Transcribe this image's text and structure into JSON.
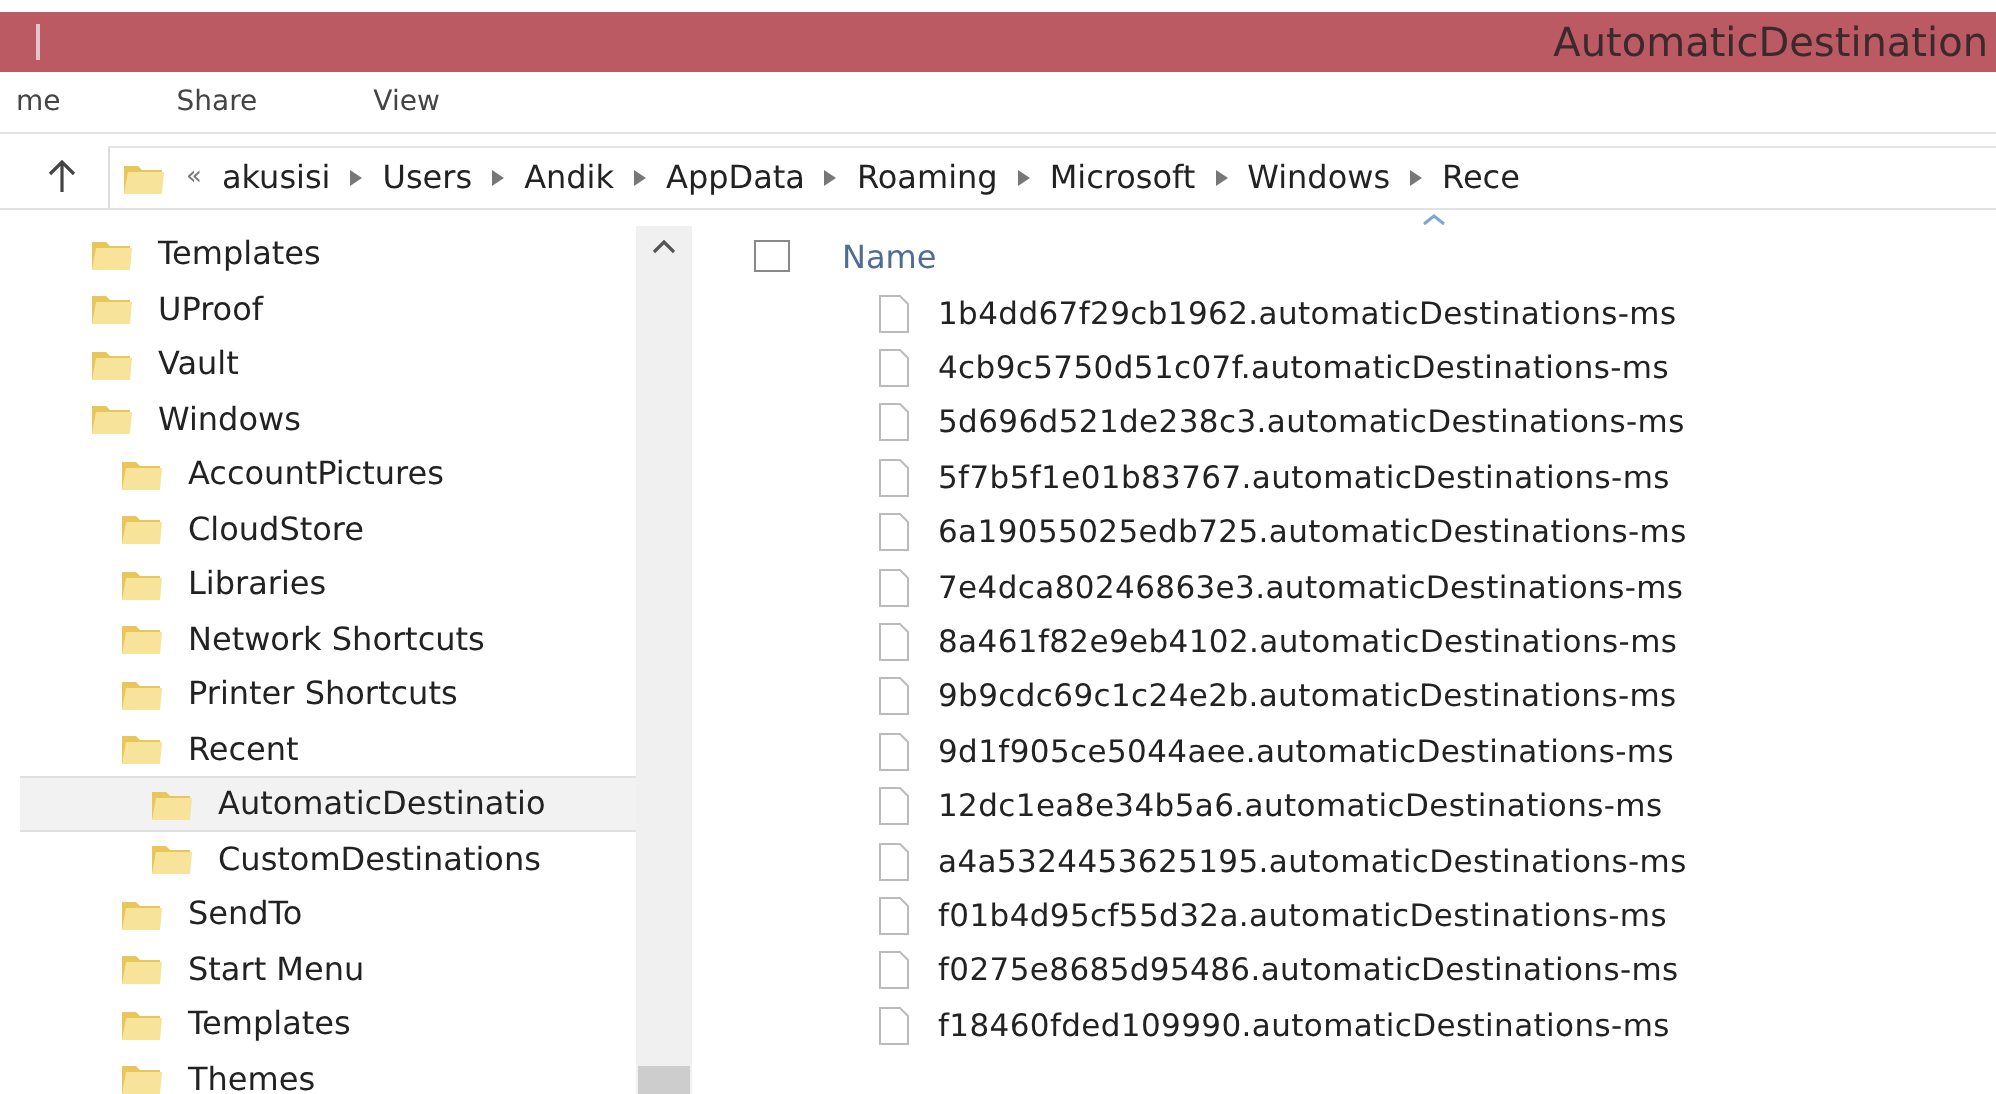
{
  "window": {
    "title": "AutomaticDestination"
  },
  "ribbon_tabs": [
    {
      "label": "me"
    },
    {
      "label": "Share"
    },
    {
      "label": "View"
    }
  ],
  "address_bar": {
    "overflow": "«",
    "path": [
      "akusisi",
      "Users",
      "Andik",
      "AppData",
      "Roaming",
      "Microsoft",
      "Windows",
      "Rece"
    ]
  },
  "navigation_tree": [
    {
      "label": "Templates",
      "selected": false
    },
    {
      "label": "UProof",
      "selected": false
    },
    {
      "label": "Vault",
      "selected": false
    },
    {
      "label": "Windows",
      "selected": false,
      "children": [
        {
          "label": "AccountPictures",
          "selected": false
        },
        {
          "label": "CloudStore",
          "selected": false
        },
        {
          "label": "Libraries",
          "selected": false
        },
        {
          "label": "Network Shortcuts",
          "selected": false
        },
        {
          "label": "Printer Shortcuts",
          "selected": false
        },
        {
          "label": "Recent",
          "selected": false,
          "children": [
            {
              "label": "AutomaticDestinatio",
              "selected": true
            },
            {
              "label": "CustomDestinations",
              "selected": false
            }
          ]
        },
        {
          "label": "SendTo",
          "selected": false
        },
        {
          "label": "Start Menu",
          "selected": false
        },
        {
          "label": "Templates",
          "selected": false
        },
        {
          "label": "Themes",
          "selected": false
        }
      ]
    }
  ],
  "file_list": {
    "select_all_checked": false,
    "columns": [
      "Name"
    ],
    "files": [
      "1b4dd67f29cb1962.automaticDestinations-ms",
      "4cb9c5750d51c07f.automaticDestinations-ms",
      "5d696d521de238c3.automaticDestinations-ms",
      "5f7b5f1e01b83767.automaticDestinations-ms",
      "6a19055025edb725.automaticDestinations-ms",
      "7e4dca80246863e3.automaticDestinations-ms",
      "8a461f82e9eb4102.automaticDestinations-ms",
      "9b9cdc69c1c24e2b.automaticDestinations-ms",
      "9d1f905ce5044aee.automaticDestinations-ms",
      "12dc1ea8e34b5a6.automaticDestinations-ms",
      "a4a5324453625195.automaticDestinations-ms",
      "f01b4d95cf55d32a.automaticDestinations-ms",
      "f0275e8685d95486.automaticDestinations-ms",
      "f18460fded109990.automaticDestinations-ms"
    ]
  }
}
